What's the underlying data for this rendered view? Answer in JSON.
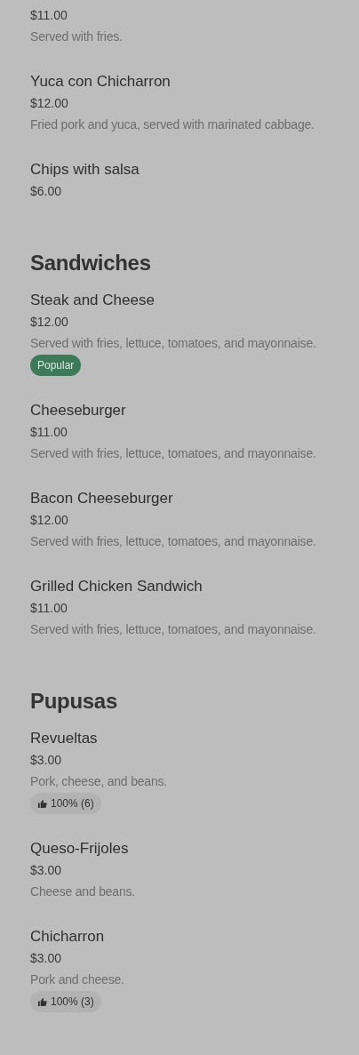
{
  "sections": [
    {
      "items": [
        {
          "price": "$11.00",
          "description": "Served with fries."
        },
        {
          "name": "Yuca con Chicharron",
          "price": "$12.00",
          "description": "Fried pork and yuca, served with marinated cabbage."
        },
        {
          "name": "Chips with salsa",
          "price": "$6.00"
        }
      ]
    },
    {
      "title": "Sandwiches",
      "items": [
        {
          "name": "Steak and Cheese",
          "price": "$12.00",
          "description": "Served with fries, lettuce, tomatoes, and mayonnaise.",
          "badge": {
            "kind": "popular",
            "label": "Popular"
          }
        },
        {
          "name": "Cheeseburger",
          "price": "$11.00",
          "description": "Served with fries, lettuce, tomatoes, and mayonnaise."
        },
        {
          "name": "Bacon Cheeseburger",
          "price": "$12.00",
          "description": "Served with fries, lettuce, tomatoes, and mayonnaise."
        },
        {
          "name": "Grilled Chicken Sandwich",
          "price": "$11.00",
          "description": "Served with fries, lettuce, tomatoes, and mayonnaise."
        }
      ]
    },
    {
      "title": "Pupusas",
      "items": [
        {
          "name": "Revueltas",
          "price": "$3.00",
          "description": "Pork, cheese, and beans.",
          "badge": {
            "kind": "rating",
            "label": "100% (6)"
          }
        },
        {
          "name": "Queso-Frijoles",
          "price": "$3.00",
          "description": "Cheese and beans."
        },
        {
          "name": "Chicharron",
          "price": "$3.00",
          "description": "Pork and cheese.",
          "badge": {
            "kind": "rating",
            "label": "100% (3)"
          }
        }
      ]
    }
  ]
}
